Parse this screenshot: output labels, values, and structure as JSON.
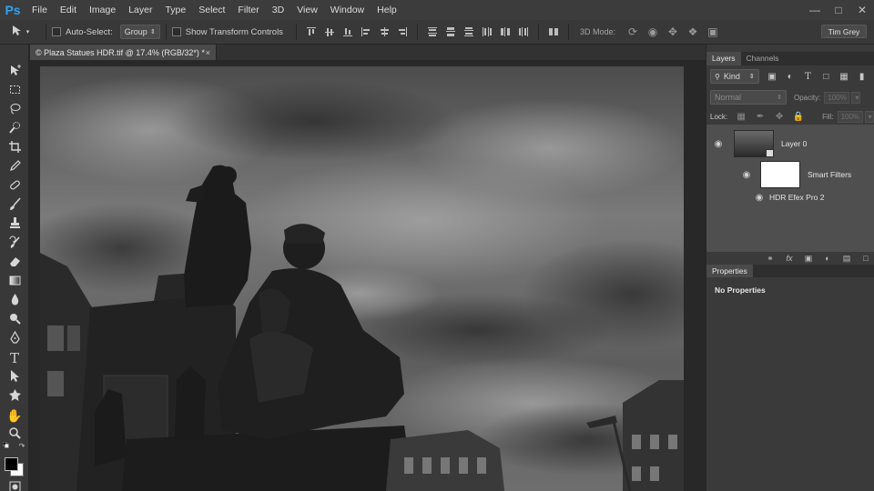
{
  "menubar": {
    "logo": "Ps",
    "items": [
      "File",
      "Edit",
      "Image",
      "Layer",
      "Type",
      "Select",
      "Filter",
      "3D",
      "View",
      "Window",
      "Help"
    ],
    "window_controls": [
      "minimize-icon",
      "restore-icon",
      "close-icon"
    ]
  },
  "options": {
    "auto_select_label": "Auto-Select:",
    "auto_select_value": "Group",
    "transform_label": "Show Transform Controls",
    "mode_3d_label": "3D Mode:",
    "workspace": "Tim Grey"
  },
  "document": {
    "tab_title": "© Plaza Statues HDR.tif @ 17.4% (RGB/32*) *",
    "tab_close": "×"
  },
  "layers_panel": {
    "tabs": [
      "Layers",
      "Channels"
    ],
    "kind_label": "Kind",
    "blend_mode": "Normal",
    "opacity_label": "Opacity:",
    "opacity_value": "100%",
    "lock_label": "Lock:",
    "fill_label": "Fill:",
    "fill_value": "100%",
    "layers": [
      {
        "name": "Layer 0"
      },
      {
        "name": "Smart Filters"
      },
      {
        "name": "HDR Efex Pro 2"
      }
    ]
  },
  "properties_panel": {
    "tab": "Properties",
    "content": "No Properties"
  },
  "colors": {
    "ps_blue": "#2fa3f2",
    "menubar": "#3c3c3c",
    "panel": "#3a3a3a",
    "layer_selected": "#4f4f4f"
  }
}
